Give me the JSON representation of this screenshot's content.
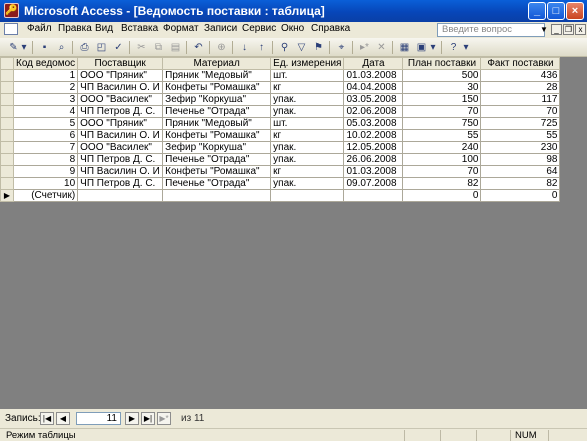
{
  "window": {
    "title": "Microsoft Access - [Ведомость поставки : таблица]"
  },
  "menu": {
    "items": [
      "Файл",
      "Правка",
      "Вид",
      "Вставка",
      "Формат",
      "Записи",
      "Сервис",
      "Окно",
      "Справка"
    ],
    "ask_placeholder": "Введите вопрос"
  },
  "table": {
    "headers": [
      "Код ведомос",
      "Поставщик",
      "Материал",
      "Ед. измерения",
      "Дата",
      "План поставки",
      "Факт поставки"
    ],
    "rows": [
      [
        "1",
        "ООО \"Пряник\"",
        "Пряник \"Медовый\"",
        "шт.",
        "01.03.2008",
        "500",
        "436"
      ],
      [
        "2",
        "ЧП Василин О. И",
        "Конфеты \"Ромашка\"",
        "кг",
        "04.04.2008",
        "30",
        "28"
      ],
      [
        "3",
        "ООО \"Василек\"",
        "Зефир \"Коркуша\"",
        "упак.",
        "03.05.2008",
        "150",
        "117"
      ],
      [
        "4",
        "ЧП Петров Д. С.",
        "Печенье \"Отрада\"",
        "упак.",
        "02.06.2008",
        "70",
        "70"
      ],
      [
        "5",
        "ООО \"Пряник\"",
        "Пряник \"Медовый\"",
        "шт.",
        "05.03.2008",
        "750",
        "725"
      ],
      [
        "6",
        "ЧП Василин О. И",
        "Конфеты \"Ромашка\"",
        "кг",
        "10.02.2008",
        "55",
        "55"
      ],
      [
        "7",
        "ООО \"Василек\"",
        "Зефир \"Коркуша\"",
        "упак.",
        "12.05.2008",
        "240",
        "230"
      ],
      [
        "8",
        "ЧП Петров Д. С.",
        "Печенье \"Отрада\"",
        "упак.",
        "26.06.2008",
        "100",
        "98"
      ],
      [
        "9",
        "ЧП Василин О. И",
        "Конфеты \"Ромашка\"",
        "кг",
        "01.03.2008",
        "70",
        "64"
      ],
      [
        "10",
        "ЧП Петров Д. С.",
        "Печенье \"Отрада\"",
        "упак.",
        "09.07.2008",
        "82",
        "82"
      ]
    ],
    "new_row": [
      "(Счетчик)",
      "",
      "",
      "",
      "",
      "0",
      "0"
    ]
  },
  "navigation": {
    "label": "Запись:",
    "current": "11",
    "of_label": "из",
    "total": "11"
  },
  "status": {
    "mode": "Режим таблицы",
    "num": "NUM"
  }
}
